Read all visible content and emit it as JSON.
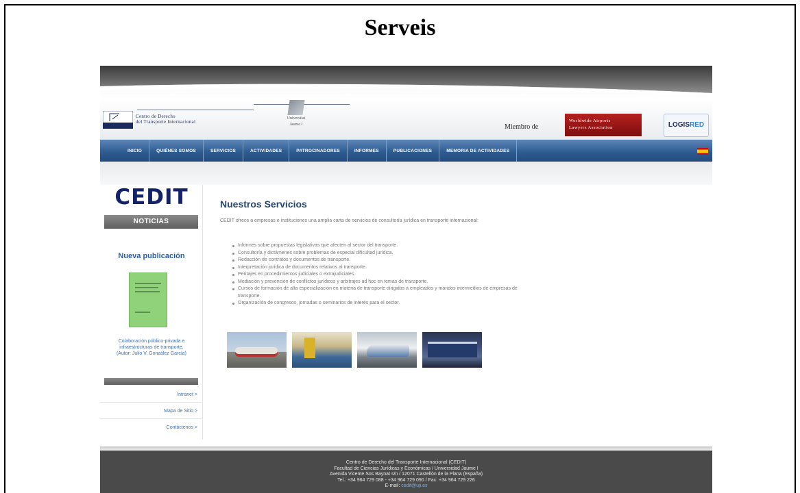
{
  "slide": {
    "title": "Serveis"
  },
  "header": {
    "logo_abbr": "CEDIT",
    "logo_line1": "Centro de Derecho",
    "logo_line2": "del Transporte Internacional",
    "university_line1": "Universitat",
    "university_line2": "Jaume I",
    "member_label": "Miembro de",
    "wala_line1": "Worldwide Airports",
    "wala_line2": "Lawyers Association",
    "logisred_a": "LOGIS",
    "logisred_b": "RED"
  },
  "nav": {
    "items": [
      "INICIO",
      "QUIÉNES SOMOS",
      "SERVICIOS",
      "ACTIVIDADES",
      "PATROCINADORES",
      "INFORMES",
      "PUBLICACIONES",
      "MEMORIA DE ACTIVIDADES"
    ],
    "flag_icon": "spain-flag-icon"
  },
  "sidebar": {
    "brand": "CEDIT",
    "section_label": "NOTICIAS",
    "news_title": "Nueva publicación",
    "news_caption_1": "Colaboración público-privada e",
    "news_caption_2": "infraestructuras de transporte.",
    "news_caption_3": "(Autor: Julio V. González García)",
    "links": [
      "Intranet  >",
      "Mapa de Sitio  >",
      "Contáctenos  >"
    ]
  },
  "main": {
    "title": "Nuestros Servicios",
    "intro": "CEDIT ofrece a empresas e instituciones una amplia carta de servicios de consultoría jurídica en transporte internacional:",
    "services": [
      "Informes sobre propuestas legislativas que afecten al sector del transporte.",
      "Consultoría y dictámenes sobre problemas de especial dificultad jurídica.",
      "Redacción de contratos y documentos de transporte.",
      "Interpretación jurídica de documentos relativos al transporte.",
      "Peritajes en procedimientos judiciales o extrajudiciales.",
      "Mediación y prevención de conflictos jurídicos y arbitrajes ad hoc en temas de transporte.",
      "Cursos de formación de alta especialización en materia de transporte dirigidos a empleados y mandos intermedios de empresas de transporte.",
      "Organización de congresos, jornadas o seminarios de interés para el sector."
    ]
  },
  "footer": {
    "line1": "Centro de Derecho del Transporte Internacional (CEDIT)",
    "line2": "Facultad de Ciencias Jurídicas y Económicas / Universidad Jaume I",
    "line3": "Avenida Vicente Sos Baynat s/n / 12071 Castellón de la Plana (España)",
    "line4": "Tel.: +34 964 729 088 - +34 964 729 090 / Fax: +34 964 729 226",
    "email_label": "E-mail:",
    "email": "cedit@uji.es"
  }
}
